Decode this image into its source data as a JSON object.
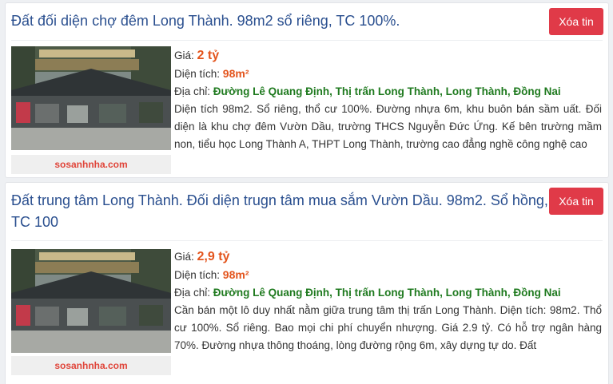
{
  "listings": [
    {
      "title": "Đất đối diện chợ đêm Long Thành. 98m2 sổ riêng, TC 100%.",
      "delete_label": "Xóa tin",
      "watermark": "sosanhnha.com",
      "price_label": "Giá:",
      "price": "2 tỷ",
      "area_label": "Diện tích:",
      "area": "98m²",
      "address_label": "Địa chỉ:",
      "address": "Đường Lê Quang Định, Thị trấn Long Thành, Long Thành, Đồng Nai",
      "description": "Diện tích 98m2. Sổ riêng, thổ cư 100%. Đường nhựa 6m, khu buôn bán sầm uất. Đối diện là khu chợ đêm Vườn Dầu, trường THCS Nguyễn Đức Ứng. Kế bên trường mầm non, tiểu học Long Thành A, THPT Long Thành, trường cao đẳng nghề công nghệ cao"
    },
    {
      "title": "Đất trung tâm Long Thành. Đối diện trugn tâm mua sắm Vườn Dầu. 98m2. Sổ hồng, TC 100",
      "delete_label": "Xóa tin",
      "watermark": "sosanhnha.com",
      "price_label": "Giá:",
      "price": "2,9 tỷ",
      "area_label": "Diện tích:",
      "area": "98m²",
      "address_label": "Địa chỉ:",
      "address": "Đường Lê Quang Định, Thị trấn Long Thành, Long Thành, Đồng Nai",
      "description": "Cần bán một lô duy nhất nằm giữa trung tâm thị trấn Long Thành. Diện tích: 98m2. Thổ cư 100%. Sổ riêng. Bao mọi chi phí chuyển nhượng. Giá 2.9 tỷ. Có hỗ trợ ngân hàng 70%. Đường nhựa thông thoáng, lòng đường rộng 6m, xây dựng tự do. Đất"
    }
  ],
  "colors": {
    "title": "#2a4f8f",
    "delete_button": "#e03a48",
    "price": "#e3541c",
    "address": "#1f7a1f",
    "watermark": "#e0453a"
  }
}
